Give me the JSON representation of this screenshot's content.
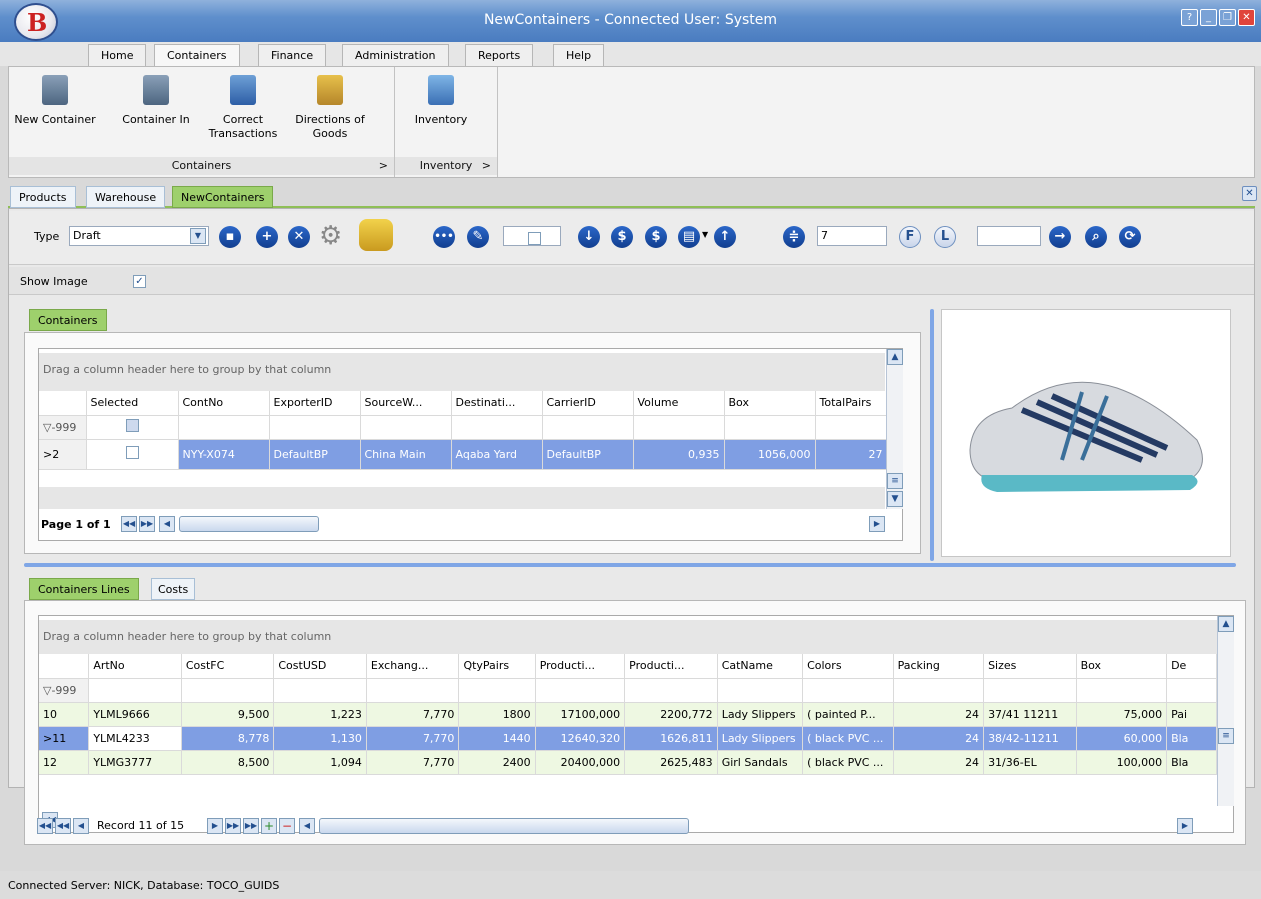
{
  "window": {
    "title": "NewContainers - Connected User: System",
    "logo_letter": "B"
  },
  "ribbon": {
    "tabs": [
      "Home",
      "Containers",
      "Finance",
      "Administration",
      "Reports",
      "Help"
    ],
    "active_tab": "Containers",
    "groups": [
      {
        "label": "Containers",
        "expander": ">",
        "buttons": [
          {
            "label": "New Container",
            "icon": "new-container-icon"
          },
          {
            "label": "Container In",
            "icon": "container-in-icon"
          },
          {
            "label": "Correct Transactions",
            "icon": "correct-transactions-icon"
          },
          {
            "label": "Directions of Goods",
            "icon": "directions-icon"
          }
        ]
      },
      {
        "label": "Inventory",
        "expander": ">",
        "buttons": [
          {
            "label": "Inventory",
            "icon": "inventory-icon"
          }
        ]
      }
    ]
  },
  "doc_tabs": [
    "Products",
    "Warehouse",
    "NewContainers"
  ],
  "toolbar": {
    "type_label": "Type",
    "type_value": "Draft",
    "number_value": "7",
    "first_label": "F",
    "last_label": "L",
    "show_image_label": "Show Image"
  },
  "containers_panel": {
    "tab": "Containers",
    "group_hint": "Drag a column header here to group by that column",
    "columns": [
      "Selected",
      "ContNo",
      "ExporterID",
      "SourceW...",
      "Destinati...",
      "CarrierID",
      "Volume",
      "Box",
      "TotalPairs"
    ],
    "filter_indicator": "▽-999",
    "rows": [
      {
        "indicator": ">2",
        "ContNo": "NYY-X074",
        "ExporterID": "DefaultBP",
        "SourceW": "China Main",
        "Destination": "Aqaba Yard",
        "CarrierID": "DefaultBP",
        "Volume": "0,935",
        "Box": "1056,000",
        "TotalPairs": "27"
      }
    ],
    "pager": "Page 1 of 1"
  },
  "lines_panel": {
    "tabs": [
      "Containers Lines",
      "Costs"
    ],
    "group_hint": "Drag a column header here to group by that column",
    "columns": [
      "ArtNo",
      "CostFC",
      "CostUSD",
      "Exchang...",
      "QtyPairs",
      "Producti...",
      "Producti...",
      "CatName",
      "Colors",
      "Packing",
      "Sizes",
      "Box",
      "De"
    ],
    "filter_indicator": "▽-999",
    "rows": [
      {
        "indicator": "10",
        "cells": [
          "YLML9666",
          "9,500",
          "1,223",
          "7,770",
          "1800",
          "17100,000",
          "2200,772",
          "Lady Slippers",
          "( painted P...",
          "24",
          "37/41 11211",
          "75,000",
          "Pai"
        ]
      },
      {
        "indicator": ">11",
        "cells": [
          "YLML4233",
          "8,778",
          "1,130",
          "7,770",
          "1440",
          "12640,320",
          "1626,811",
          "Lady Slippers",
          "( black PVC ...",
          "24",
          "38/42-11211",
          "60,000",
          "Bla"
        ]
      },
      {
        "indicator": "12",
        "cells": [
          "YLMG3777",
          "8,500",
          "1,094",
          "7,770",
          "2400",
          "20400,000",
          "2625,483",
          "Girl Sandals",
          "( black PVC ...",
          "24",
          "31/36-EL",
          "100,000",
          "Bla"
        ]
      }
    ],
    "record_nav": "Record 11 of 15"
  },
  "status": {
    "text": "Connected Server: NICK, Database: TOCO_GUIDS"
  },
  "colors": {
    "accent_green": "#9ed06c",
    "selection_blue": "#7f9ee3",
    "titlebar": "#4a7cc0"
  }
}
